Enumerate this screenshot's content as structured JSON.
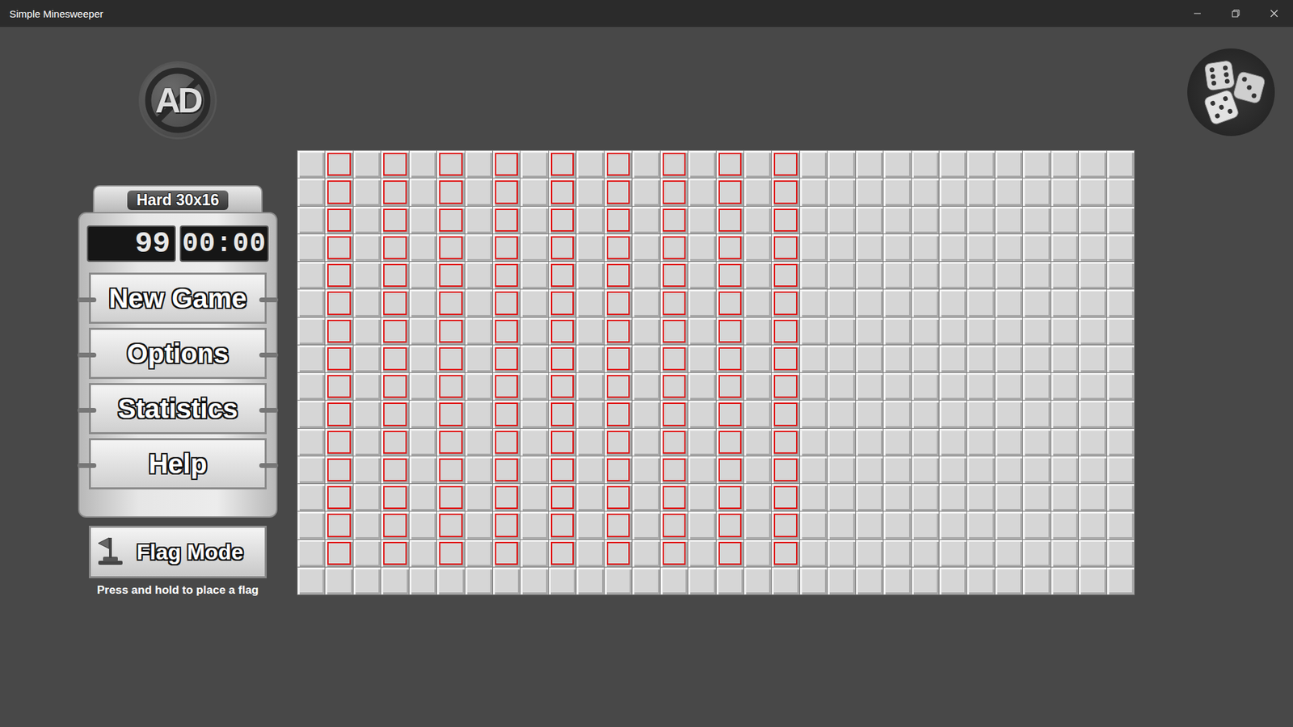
{
  "window": {
    "title": "Simple Minesweeper"
  },
  "ad_badge": "AD",
  "difficulty": "Hard 30x16",
  "mine_counter": "99",
  "timer": "00:00",
  "menu": [
    "New Game",
    "Options",
    "Statistics",
    "Help"
  ],
  "flag_mode": {
    "label": "Flag Mode",
    "on": false
  },
  "hint": "Press and hold to place a flag",
  "board": {
    "rows": 16,
    "cols": 30,
    "highlighted": [
      [
        false,
        true,
        false,
        true,
        false,
        true,
        false,
        true,
        false,
        true,
        false,
        true,
        false,
        true,
        false,
        true,
        false,
        true,
        false,
        false,
        false,
        false,
        false,
        false,
        false,
        false,
        false,
        false,
        false,
        false
      ],
      [
        false,
        true,
        false,
        true,
        false,
        true,
        false,
        true,
        false,
        true,
        false,
        true,
        false,
        true,
        false,
        true,
        false,
        true,
        false,
        false,
        false,
        false,
        false,
        false,
        false,
        false,
        false,
        false,
        false,
        false
      ],
      [
        false,
        true,
        false,
        true,
        false,
        true,
        false,
        true,
        false,
        true,
        false,
        true,
        false,
        true,
        false,
        true,
        false,
        true,
        false,
        false,
        false,
        false,
        false,
        false,
        false,
        false,
        false,
        false,
        false,
        false
      ],
      [
        false,
        true,
        false,
        true,
        false,
        true,
        false,
        true,
        false,
        true,
        false,
        true,
        false,
        true,
        false,
        true,
        false,
        true,
        false,
        false,
        false,
        false,
        false,
        false,
        false,
        false,
        false,
        false,
        false,
        false
      ],
      [
        false,
        true,
        false,
        true,
        false,
        true,
        false,
        true,
        false,
        true,
        false,
        true,
        false,
        true,
        false,
        true,
        false,
        true,
        false,
        false,
        false,
        false,
        false,
        false,
        false,
        false,
        false,
        false,
        false,
        false
      ],
      [
        false,
        true,
        false,
        true,
        false,
        true,
        false,
        true,
        false,
        true,
        false,
        true,
        false,
        true,
        false,
        true,
        false,
        true,
        false,
        false,
        false,
        false,
        false,
        false,
        false,
        false,
        false,
        false,
        false,
        false
      ],
      [
        false,
        true,
        false,
        true,
        false,
        true,
        false,
        true,
        false,
        true,
        false,
        true,
        false,
        true,
        false,
        true,
        false,
        true,
        false,
        false,
        false,
        false,
        false,
        false,
        false,
        false,
        false,
        false,
        false,
        false
      ],
      [
        false,
        true,
        false,
        true,
        false,
        true,
        false,
        true,
        false,
        true,
        false,
        true,
        false,
        true,
        false,
        true,
        false,
        true,
        false,
        false,
        false,
        false,
        false,
        false,
        false,
        false,
        false,
        false,
        false,
        false
      ],
      [
        false,
        true,
        false,
        true,
        false,
        true,
        false,
        true,
        false,
        true,
        false,
        true,
        false,
        true,
        false,
        true,
        false,
        true,
        false,
        false,
        false,
        false,
        false,
        false,
        false,
        false,
        false,
        false,
        false,
        false
      ],
      [
        false,
        true,
        false,
        true,
        false,
        true,
        false,
        true,
        false,
        true,
        false,
        true,
        false,
        true,
        false,
        true,
        false,
        true,
        false,
        false,
        false,
        false,
        false,
        false,
        false,
        false,
        false,
        false,
        false,
        false
      ],
      [
        false,
        true,
        false,
        true,
        false,
        true,
        false,
        true,
        false,
        true,
        false,
        true,
        false,
        true,
        false,
        true,
        false,
        true,
        false,
        false,
        false,
        false,
        false,
        false,
        false,
        false,
        false,
        false,
        false,
        false
      ],
      [
        false,
        true,
        false,
        true,
        false,
        true,
        false,
        true,
        false,
        true,
        false,
        true,
        false,
        true,
        false,
        true,
        false,
        true,
        false,
        false,
        false,
        false,
        false,
        false,
        false,
        false,
        false,
        false,
        false,
        false
      ],
      [
        false,
        true,
        false,
        true,
        false,
        true,
        false,
        true,
        false,
        true,
        false,
        true,
        false,
        true,
        false,
        true,
        false,
        true,
        false,
        false,
        false,
        false,
        false,
        false,
        false,
        false,
        false,
        false,
        false,
        false
      ],
      [
        false,
        true,
        false,
        true,
        false,
        true,
        false,
        true,
        false,
        true,
        false,
        true,
        false,
        true,
        false,
        true,
        false,
        true,
        false,
        false,
        false,
        false,
        false,
        false,
        false,
        false,
        false,
        false,
        false,
        false
      ],
      [
        false,
        true,
        false,
        true,
        false,
        true,
        false,
        true,
        false,
        true,
        false,
        true,
        false,
        true,
        false,
        true,
        false,
        true,
        false,
        false,
        false,
        false,
        false,
        false,
        false,
        false,
        false,
        false,
        false,
        false
      ],
      [
        false,
        false,
        false,
        false,
        false,
        false,
        false,
        false,
        false,
        false,
        false,
        false,
        false,
        false,
        false,
        false,
        false,
        false,
        false,
        false,
        false,
        false,
        false,
        false,
        false,
        false,
        false,
        false,
        false,
        false
      ]
    ]
  }
}
